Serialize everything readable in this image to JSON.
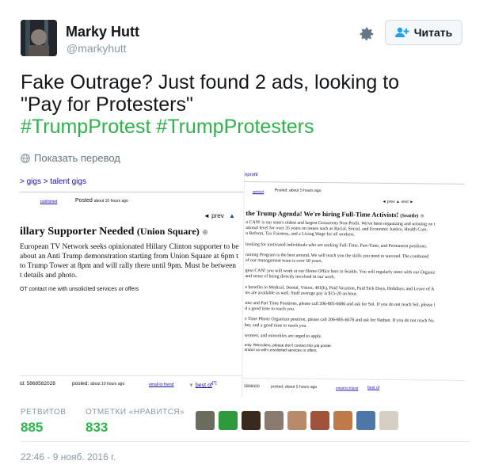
{
  "author": {
    "name": "Marky Hutt",
    "handle": "@markyhutt"
  },
  "follow_label": "Читать",
  "tweet": {
    "line1": "Fake Outrage? Just found 2 ads, looking to",
    "line2": "\"Pay for Protesters\"",
    "hashtag1": "#TrumpProtest",
    "hashtag2": "#TrumpProtesters"
  },
  "translate_label": "Показать перевод",
  "photo": {
    "left": {
      "breadcrumb": "> gigs > talent gigs",
      "published": "published",
      "posted_label": "Posted",
      "posted_time": "about 10 hours ago",
      "prev": "◄ prev",
      "title": "illary Supporter Needed",
      "title_loc": "(Union Square)",
      "body": [
        "European TV Network seeks opinionated Hillary Clinton supporter to be",
        "about an Anti Trump demonstration starting from Union Square at 6pm t",
        "to Trump Tower at 8pm and will rally there until 9pm. Must be between",
        "t details and photo."
      ],
      "notice": "OT contact me with unsolicited services or offers",
      "footer_id": "id: 5868582028",
      "footer_posted": "posted:",
      "footer_time": "about 10 hours ago",
      "footer_email": "email to friend",
      "footer_best": "best of"
    },
    "right": {
      "header": "nprofit",
      "updated": "updated",
      "posted": "Posted: about 5 hours ago",
      "nav": "◄ prev  ▲  next ►",
      "title": "the Trump Agenda! We're hiring Full-Time Activists!",
      "title_loc": "(Seattle)",
      "paragraphs": [
        [
          "n CAN! is our state's oldest and largest Grassroots Non-Profit. We've been organizing and winning on t",
          "ational level for over 35 years on issues such as Racial, Social, and Economic Justice, Health Care,",
          "n Reform, Tax Fairness, and a Living Wage for all workers."
        ],
        [
          "looking for motivated individuals who are seeking Full-Time, Part-Time, and Permanent positions."
        ],
        [
          "raining Program is the best around. We will teach you the skills you need to succeed. The combined",
          "of our management team is over 50 years."
        ],
        [
          "gton CAN! you will work at our Home Office here in Seattle. You will regularly meet with our Organiz",
          "and sense of being directly involved in our work."
        ],
        [
          "e benefits in Medical, Dental, Vision, 401(k), Paid Vacation, Paid Sick Days, Holidays, and Leave of A",
          "ies are available as well. Staff average pay is $15-20 an hour."
        ],
        [
          "ime and Part Time Positions, please call 206-805-6686 and ask for Sol. If you do not reach Sol, please l",
          "d a good time to reach you."
        ],
        [
          "e Time Phone Organizer position, please call 206-805-6678 and ask for Nathan. If you do not reach Na",
          "ber, and a good time to reach you."
        ],
        [
          "women, and minorities are urged to apply."
        ],
        [
          "only. Recruiters, please don't contact this job poster.",
          "ontact us with unsolicited services or offers"
        ]
      ],
      "footer_id": "5808320",
      "footer_posted": "posted: about 5 hours ago",
      "footer_email": "email to friend",
      "footer_best": "best of"
    }
  },
  "stats": {
    "retweets_label": "РЕТВИТОВ",
    "retweets": "885",
    "likes_label": "ОТМЕТКИ «НРАВИТСЯ»",
    "likes": "833"
  },
  "liker_colors": [
    "#6b6b5e",
    "#2f9a3b",
    "#3a2a1e",
    "#8a7a70",
    "#b98a6a",
    "#a0523a",
    "#c07a4a",
    "#4c77a8",
    "#d6cfc4"
  ],
  "timestamp": "22:46 - 9 нояб. 2016 г."
}
